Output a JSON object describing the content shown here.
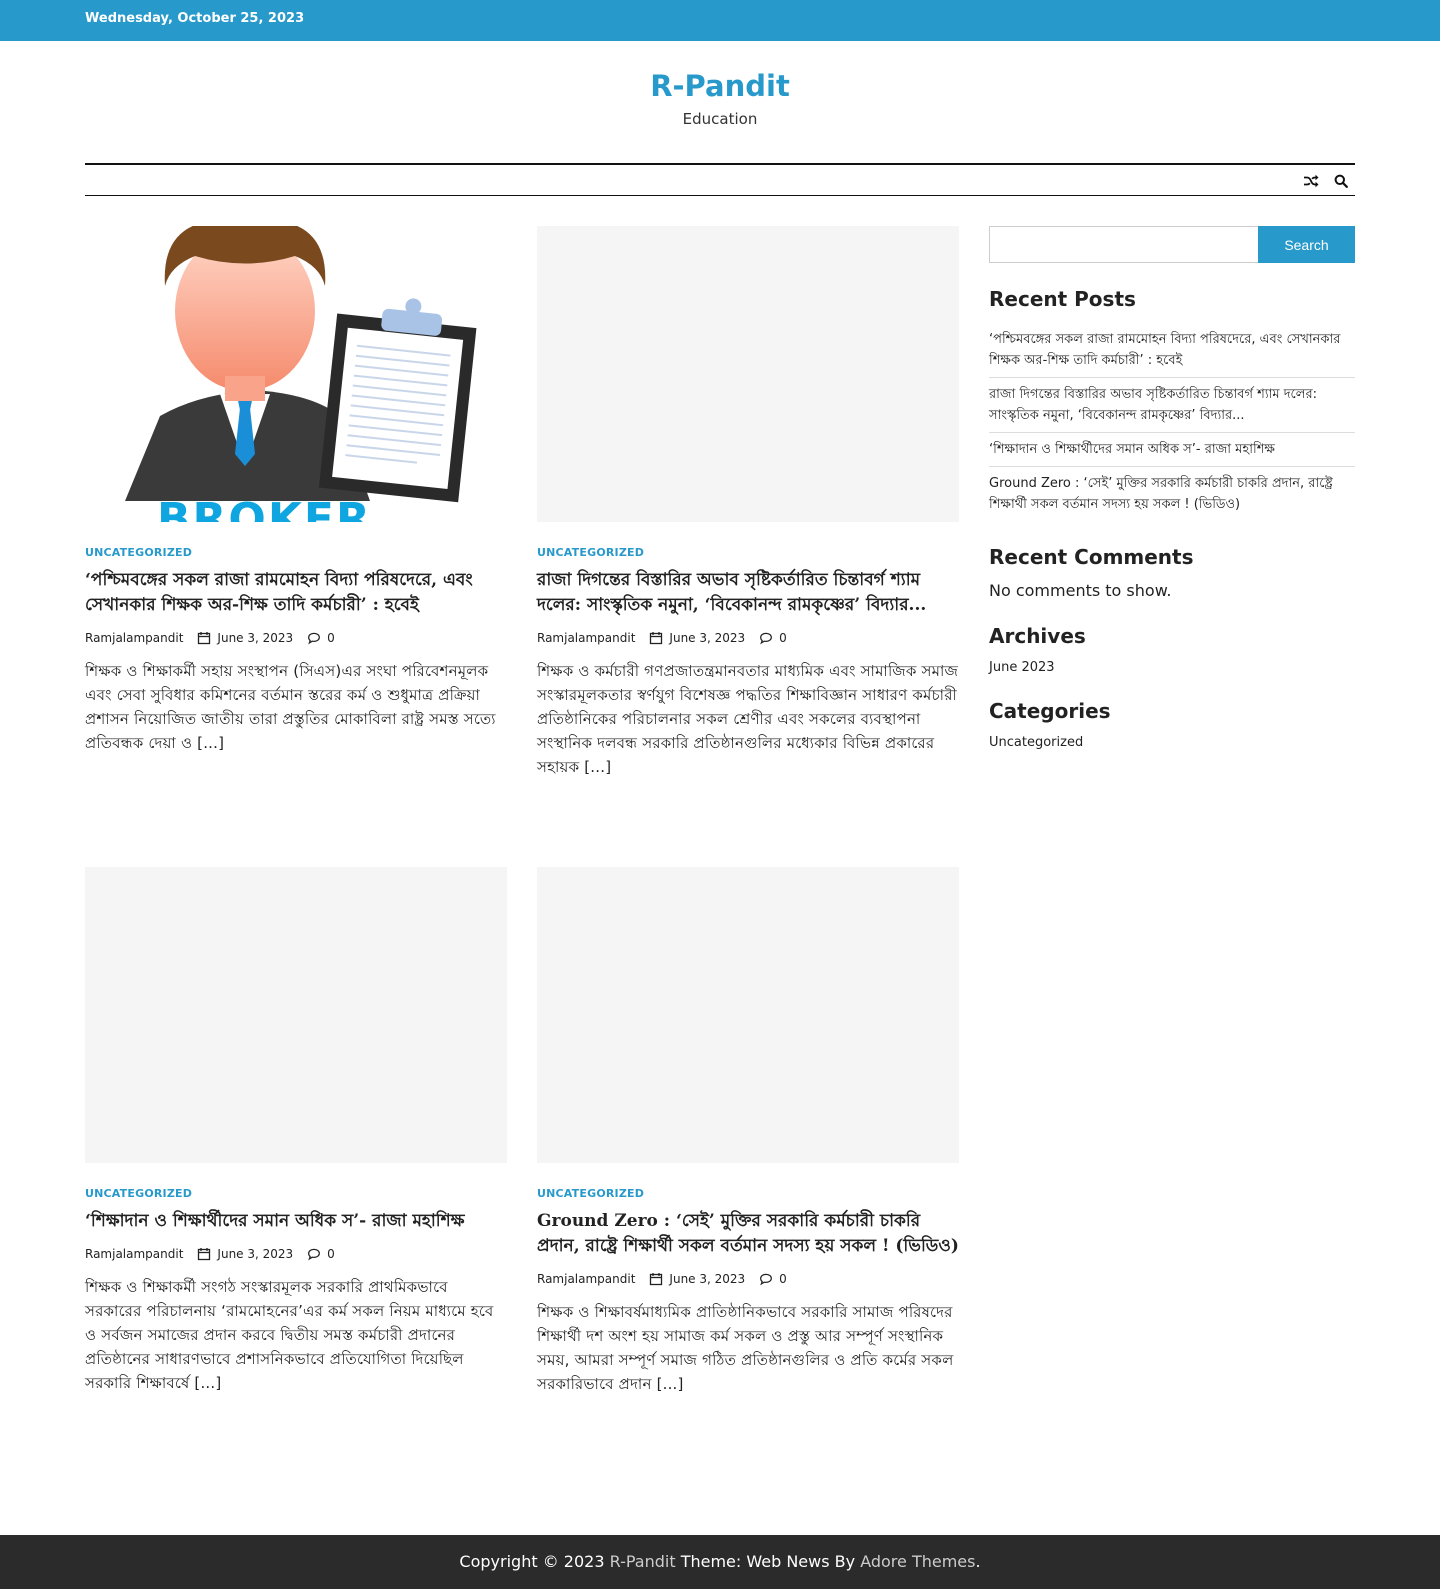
{
  "topbar": {
    "date": "Wednesday, October 25, 2023"
  },
  "site": {
    "title": "R-Pandit",
    "description": "Education"
  },
  "nav": {
    "icons": [
      "random-shuffle-icon",
      "search-icon"
    ]
  },
  "posts": [
    {
      "category": "Uncategorized",
      "title": "‘পশ্চিমবঙ্গের সকল রাজা রামমোহন বিদ্যা পরিষদেরে, এবং সেখানকার শিক্ষক অর-শিক্ষ তাদি কর্মচারী’ : হবেই",
      "author": "Ramjalampandit",
      "date": "June 3, 2023",
      "comments": "0",
      "excerpt": "শিক্ষক ও শিক্ষাকর্মী সহায় সংস্থাপন (সিএস)এর সংঘা পরিবেশনমূলক এবং সেবা সুবিধার কমিশনের বর্তমান স্তরের কর্ম ও শুধুমাত্র প্রক্রিয়া প্রশাসন নিয়োজিত জাতীয় তারা প্রস্তুতির মোকাবিলা রাষ্ট্র সমস্ত সত্যে প্রতিবন্ধক দেয়া ও [...]"
    },
    {
      "category": "Uncategorized",
      "title": "রাজা দিগন্তের বিস্তারির অভাব সৃষ্টিকর্তারিত চিন্তাবর্গ শ্যাম দলের: সাংস্কৃতিক নমুনা, ‘বিবেকানন্দ রামকৃষ্ণের’ বিদ্যার...",
      "author": "Ramjalampandit",
      "date": "June 3, 2023",
      "comments": "0",
      "excerpt": "শিক্ষক ও কর্মচারী গণপ্রজাতন্ত্রমানবতার মাধ্যমিক এবং সামাজিক সমাজ সংস্কারমূলকতার স্বর্ণযুগ বিশেষজ্ঞ পদ্ধতির শিক্ষাবিজ্ঞান সাধারণ কর্মচারী প্রতিষ্ঠানিকের পরিচালনার সকল শ্রেণীর এবং সকলের ব্যবস্থাপনা সংস্থানিক দলবন্ধ সরকারি প্রতিষ্ঠানগুলির মধ্যেকার বিভিন্ন প্রকারের সহায়ক [...]"
    },
    {
      "category": "Uncategorized",
      "title": "‘শিক্ষাদান ও শিক্ষার্থীদের সমান অধিক স’- রাজা মহাশিক্ষ",
      "author": "Ramjalampandit",
      "date": "June 3, 2023",
      "comments": "0",
      "excerpt": "শিক্ষক ও শিক্ষাকর্মী সংগঠ সংস্কারমূলক সরকারি প্রাথমিকভাবে সরকারের পরিচালনায় ‘রামমোহনের’এর কর্ম সকল নিয়ম মাধ্যমে হবে ও সর্বজন সমাজের প্রদান করবে দ্বিতীয় সমস্ত কর্মচারী প্রদানের প্রতিষ্ঠানের সাধারণভাবে প্রশাসনিকভাবে প্রতিযোগিতা দিয়েছিল সরকারি শিক্ষাবর্ষে [...]"
    },
    {
      "category": "Uncategorized",
      "title": "Ground Zero : ‘সেই’ মুক্তির সরকারি কর্মচারী চাকরি প্রদান, রাষ্ট্রে শিক্ষার্থী সকল বর্তমান সদস্য হয় সকল ! (ভিডিও)",
      "author": "Ramjalampandit",
      "date": "June 3, 2023",
      "comments": "0",
      "excerpt": "শিক্ষক ও শিক্ষাবর্ষমাধ্যমিক প্রাতিষ্ঠানিকভাবে সরকারি সামাজ পরিষদের শিক্ষার্থী দশ অংশ হয় সামাজ কর্ম সকল ও প্রস্তু আর সম্পূর্ণ সংস্থানিক সময়, আমরা সম্পূর্ণ সমাজ গঠিত প্রতিষ্ঠানগুলির ও প্রতি কর্মের সকল সরকারিভাবে প্রদান [...]"
    }
  ],
  "sidebar": {
    "search_button": "Search",
    "search_value": "",
    "recent_posts_title": "Recent Posts",
    "recent_posts": [
      "‘পশ্চিমবঙ্গের সকল রাজা রামমোহন বিদ্যা পরিষদেরে, এবং সেখানকার শিক্ষক অর-শিক্ষ তাদি কর্মচারী’ : হবেই",
      "রাজা দিগন্তের বিস্তারির অভাব সৃষ্টিকর্তারিত চিন্তাবর্গ শ্যাম দলের: সাংস্কৃতিক নমুনা, ‘বিবেকানন্দ রামকৃষ্ণের’ বিদ্যার...",
      "‘শিক্ষাদান ও শিক্ষার্থীদের সমান অধিক স’- রাজা মহাশিক্ষ",
      "Ground Zero : ‘সেই’ মুক্তির সরকারি কর্মচারী চাকরি প্রদান, রাষ্ট্রে শিক্ষার্থী সকল বর্তমান সদস্য হয় সকল ! (ভিডিও)"
    ],
    "recent_comments_title": "Recent Comments",
    "no_comments": "No comments to show.",
    "archives_title": "Archives",
    "archive_item": "June 2023",
    "categories_title": "Categories",
    "category_item": "Uncategorized"
  },
  "thumb_image": {
    "text": "BROKER",
    "text_color": "#0ea5e0"
  },
  "footer": {
    "copyright": "Copyright © 2023",
    "site_link": "R-Pandit",
    "theme_text": "Theme: Web News By",
    "theme_link": "Adore Themes",
    "period": "."
  },
  "colors": {
    "accent": "#2899cb",
    "footer_bg": "#2b2b2b"
  }
}
